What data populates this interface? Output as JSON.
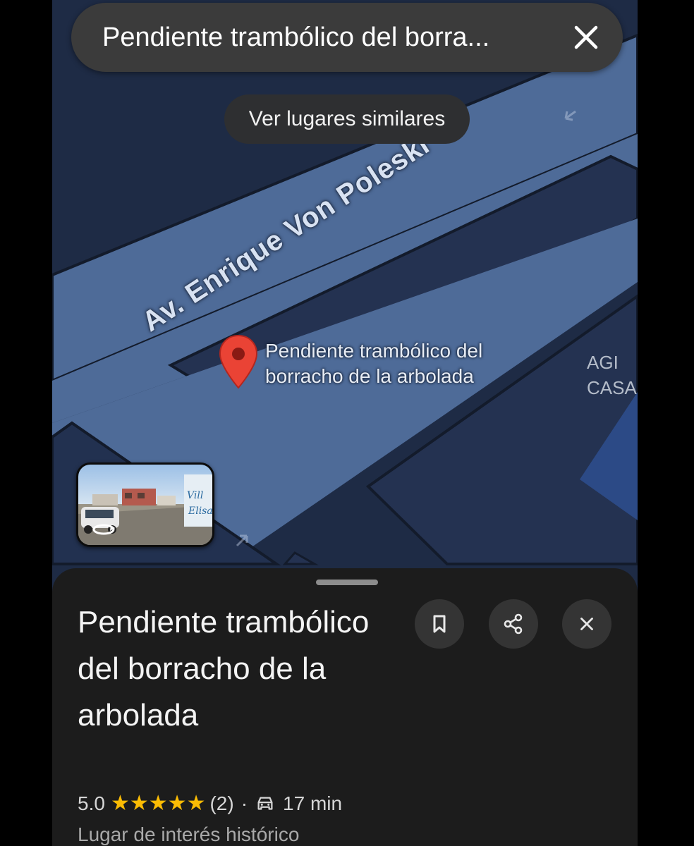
{
  "search": {
    "query": "Pendiente trambólico del borra..."
  },
  "chip": {
    "label": "Ver lugares similares"
  },
  "map": {
    "street_name": "Av. Enrique Von Poleski",
    "pin_label_line1": "Pendiente trambólico del",
    "pin_label_line2": "borracho de la arbolada",
    "edge_place_line1": "AGI",
    "edge_place_line2": "CASA",
    "pin_color": "#ea4335"
  },
  "sheet": {
    "title": "Pendiente trambólico del borracho de la arbolada",
    "rating": "5.0",
    "stars": 5,
    "review_count": "(2)",
    "separator": "·",
    "drive_time": "17 min",
    "category": "Lugar de interés histórico"
  },
  "colors": {
    "map_bg": "#1e2b45",
    "road": "#4e6b98",
    "sheet_bg": "#1c1c1c",
    "star": "#fbbc04"
  }
}
